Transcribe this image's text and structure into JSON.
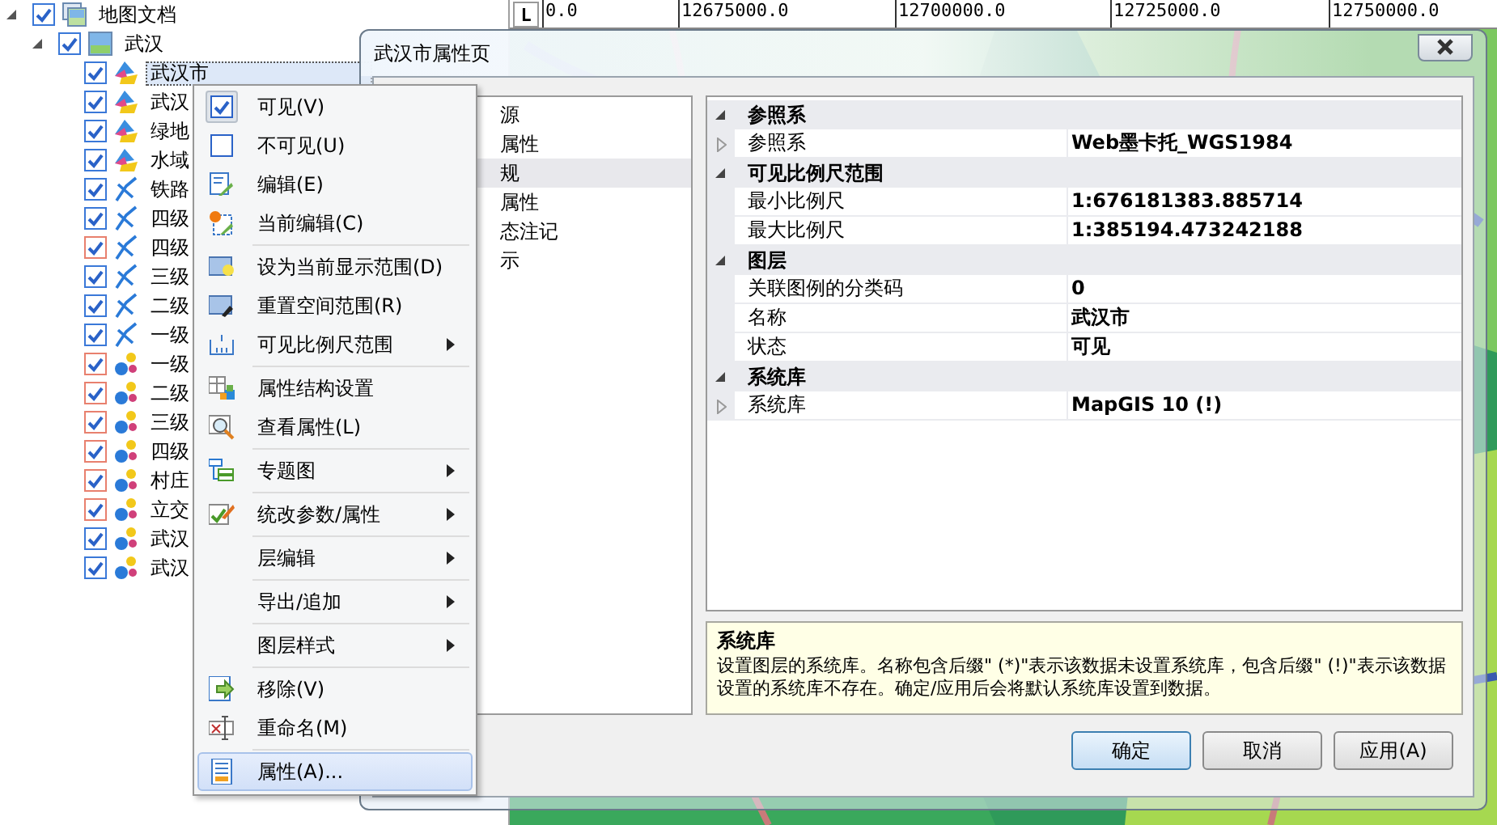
{
  "layer_tree": {
    "items": [
      {
        "label": "地图文档",
        "kind": "document",
        "checked": true,
        "color": "#3a78d8",
        "selected": false,
        "expanded": true,
        "children": [
          {
            "label": "武汉",
            "kind": "map",
            "checked": true,
            "color": "#3a78d8",
            "selected": false,
            "expanded": true,
            "children": [
              {
                "label": "武汉市",
                "kind": "region",
                "checked": true,
                "color": "#3a78d8",
                "selected": true
              },
              {
                "label": "武汉",
                "kind": "region",
                "checked": true,
                "color": "#3a78d8",
                "selected": false
              },
              {
                "label": "绿地",
                "kind": "region",
                "checked": true,
                "color": "#3a78d8",
                "selected": false
              },
              {
                "label": "水域",
                "kind": "region",
                "checked": true,
                "color": "#3a78d8",
                "selected": false
              },
              {
                "label": "铁路",
                "kind": "line",
                "checked": true,
                "color": "#3a78d8",
                "selected": false
              },
              {
                "label": "四级",
                "kind": "line",
                "checked": true,
                "color": "#3a78d8",
                "selected": false
              },
              {
                "label": "四级",
                "kind": "line",
                "checked": true,
                "color": "#e8806e",
                "selected": false
              },
              {
                "label": "三级",
                "kind": "line",
                "checked": true,
                "color": "#3a78d8",
                "selected": false
              },
              {
                "label": "二级",
                "kind": "line",
                "checked": true,
                "color": "#3a78d8",
                "selected": false
              },
              {
                "label": "一级",
                "kind": "line",
                "checked": true,
                "color": "#3a78d8",
                "selected": false
              },
              {
                "label": "一级",
                "kind": "point",
                "checked": true,
                "color": "#e8806e",
                "selected": false
              },
              {
                "label": "二级",
                "kind": "point",
                "checked": true,
                "color": "#e8806e",
                "selected": false
              },
              {
                "label": "三级",
                "kind": "point",
                "checked": true,
                "color": "#e8806e",
                "selected": false
              },
              {
                "label": "四级",
                "kind": "point",
                "checked": true,
                "color": "#e8806e",
                "selected": false
              },
              {
                "label": "村庄",
                "kind": "point",
                "checked": true,
                "color": "#e8806e",
                "selected": false
              },
              {
                "label": "立交",
                "kind": "point",
                "checked": true,
                "color": "#e8806e",
                "selected": false
              },
              {
                "label": "武汉",
                "kind": "point",
                "checked": true,
                "color": "#3a78d8",
                "selected": false
              },
              {
                "label": "武汉",
                "kind": "point",
                "checked": true,
                "color": "#3a78d8",
                "selected": false
              }
            ]
          }
        ]
      }
    ]
  },
  "ruler": {
    "corner": "L",
    "ticks": [
      "0.0",
      "12675000.0",
      "12700000.0",
      "12725000.0",
      "12750000.0"
    ]
  },
  "dialog": {
    "title": "武汉市属性页",
    "nav": [
      {
        "label": "源",
        "selected": false
      },
      {
        "label": "属性",
        "selected": false
      },
      {
        "label": "规",
        "selected": true
      },
      {
        "label": "属性",
        "selected": false
      },
      {
        "label": "态注记",
        "selected": false
      },
      {
        "label": "示",
        "selected": false
      }
    ],
    "property_grid": [
      {
        "category": "参照系",
        "expanded": true,
        "rows": [
          {
            "name": "参照系",
            "value": "Web墨卡托_WGS1984",
            "expandable": true
          }
        ]
      },
      {
        "category": "可见比例尺范围",
        "expanded": true,
        "rows": [
          {
            "name": "最小比例尺",
            "value": "1:676181383.885714",
            "expandable": false
          },
          {
            "name": "最大比例尺",
            "value": "1:385194.473242188",
            "expandable": false
          }
        ]
      },
      {
        "category": "图层",
        "expanded": true,
        "rows": [
          {
            "name": "关联图例的分类码",
            "value": "0",
            "expandable": false
          },
          {
            "name": "名称",
            "value": "武汉市",
            "expandable": false
          },
          {
            "name": "状态",
            "value": "可见",
            "expandable": false
          }
        ]
      },
      {
        "category": "系统库",
        "expanded": true,
        "rows": [
          {
            "name": "系统库",
            "value": "MapGIS 10 (!)",
            "expandable": true
          }
        ]
      }
    ],
    "description": {
      "title": "系统库",
      "text": "设置图层的系统库。名称包含后缀\" (*)\"表示该数据未设置系统库，包含后缀\" (!)\"表示该数据设置的系统库不存在。确定/应用后会将默认系统库设置到数据。"
    },
    "buttons": [
      {
        "label": "确定",
        "default": true
      },
      {
        "label": "取消",
        "default": false
      },
      {
        "label": "应用(A)",
        "default": false
      }
    ]
  },
  "context_menu": {
    "items": [
      {
        "kind": "check",
        "label": "可见(V)",
        "checked": true,
        "submenu": false,
        "selected": false
      },
      {
        "kind": "check",
        "label": "不可见(U)",
        "checked": false,
        "submenu": false,
        "selected": false
      },
      {
        "kind": "edit",
        "label": "编辑(E)",
        "submenu": false,
        "selected": false
      },
      {
        "kind": "current",
        "label": "当前编辑(C)",
        "submenu": false,
        "selected": false
      },
      {
        "kind": "separator"
      },
      {
        "kind": "display",
        "label": "设为当前显示范围(D)",
        "submenu": false,
        "selected": false
      },
      {
        "kind": "reset",
        "label": "重置空间范围(R)",
        "submenu": false,
        "selected": false
      },
      {
        "kind": "scale",
        "label": "可见比例尺范围",
        "submenu": true,
        "selected": false
      },
      {
        "kind": "separator"
      },
      {
        "kind": "schema",
        "label": "属性结构设置",
        "submenu": false,
        "selected": false
      },
      {
        "kind": "view",
        "label": "查看属性(L)",
        "submenu": false,
        "selected": false
      },
      {
        "kind": "separator"
      },
      {
        "kind": "thematic",
        "label": "专题图",
        "submenu": true,
        "selected": false
      },
      {
        "kind": "separator"
      },
      {
        "kind": "batch",
        "label": "统改参数/属性",
        "submenu": true,
        "selected": false
      },
      {
        "kind": "separator"
      },
      {
        "kind": "plain",
        "label": "层编辑",
        "submenu": true,
        "selected": false
      },
      {
        "kind": "separator"
      },
      {
        "kind": "plain",
        "label": "导出/追加",
        "submenu": true,
        "selected": false
      },
      {
        "kind": "separator"
      },
      {
        "kind": "plain",
        "label": "图层样式",
        "submenu": true,
        "selected": false
      },
      {
        "kind": "separator"
      },
      {
        "kind": "remove",
        "label": "移除(V)",
        "submenu": false,
        "selected": false
      },
      {
        "kind": "rename",
        "label": "重命名(M)",
        "submenu": false,
        "selected": false
      },
      {
        "kind": "separator"
      },
      {
        "kind": "properties",
        "label": "属性(A)...",
        "submenu": false,
        "selected": true
      }
    ]
  }
}
